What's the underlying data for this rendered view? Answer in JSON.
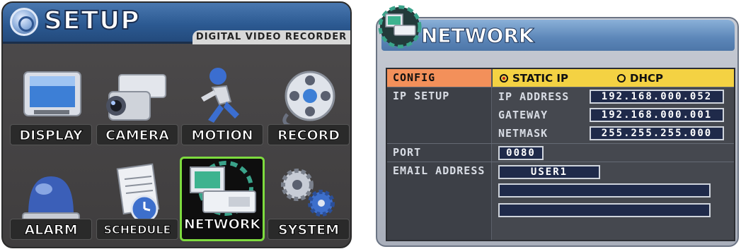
{
  "setup": {
    "title": "SETUP",
    "subtitle": "DIGITAL VIDEO RECORDER",
    "menu": [
      {
        "label": "DISPLAY",
        "icon": "monitor-icon"
      },
      {
        "label": "CAMERA",
        "icon": "camera-icon"
      },
      {
        "label": "MOTION",
        "icon": "running-figure-icon"
      },
      {
        "label": "RECORD",
        "icon": "film-reel-icon"
      },
      {
        "label": "ALARM",
        "icon": "alarm-light-icon"
      },
      {
        "label": "SCHEDULE",
        "icon": "calendar-clock-icon"
      },
      {
        "label": "NETWORK",
        "icon": "network-dvr-icon",
        "selected": true
      },
      {
        "label": "SYSTEM",
        "icon": "gears-icon"
      }
    ]
  },
  "network": {
    "title": "NETWORK",
    "config": {
      "label": "CONFIG",
      "options": [
        "STATIC IP",
        "DHCP"
      ],
      "selected": "STATIC IP"
    },
    "ip_setup": {
      "label": "IP SETUP",
      "fields": [
        {
          "label": "IP ADDRESS",
          "value": "192.168.000.052"
        },
        {
          "label": "GATEWAY",
          "value": "192.168.000.001"
        },
        {
          "label": "NETMASK",
          "value": "255.255.255.000"
        }
      ]
    },
    "port": {
      "label": "PORT",
      "value": "0080"
    },
    "email": {
      "label": "EMAIL ADDRESS",
      "values": [
        "USER1",
        "",
        ""
      ]
    }
  },
  "colors": {
    "highlight_key": "#f3905a",
    "highlight_value": "#f4d243",
    "selected_tile_border": "#7ddb3e",
    "header_blue": "#2c5a92"
  }
}
